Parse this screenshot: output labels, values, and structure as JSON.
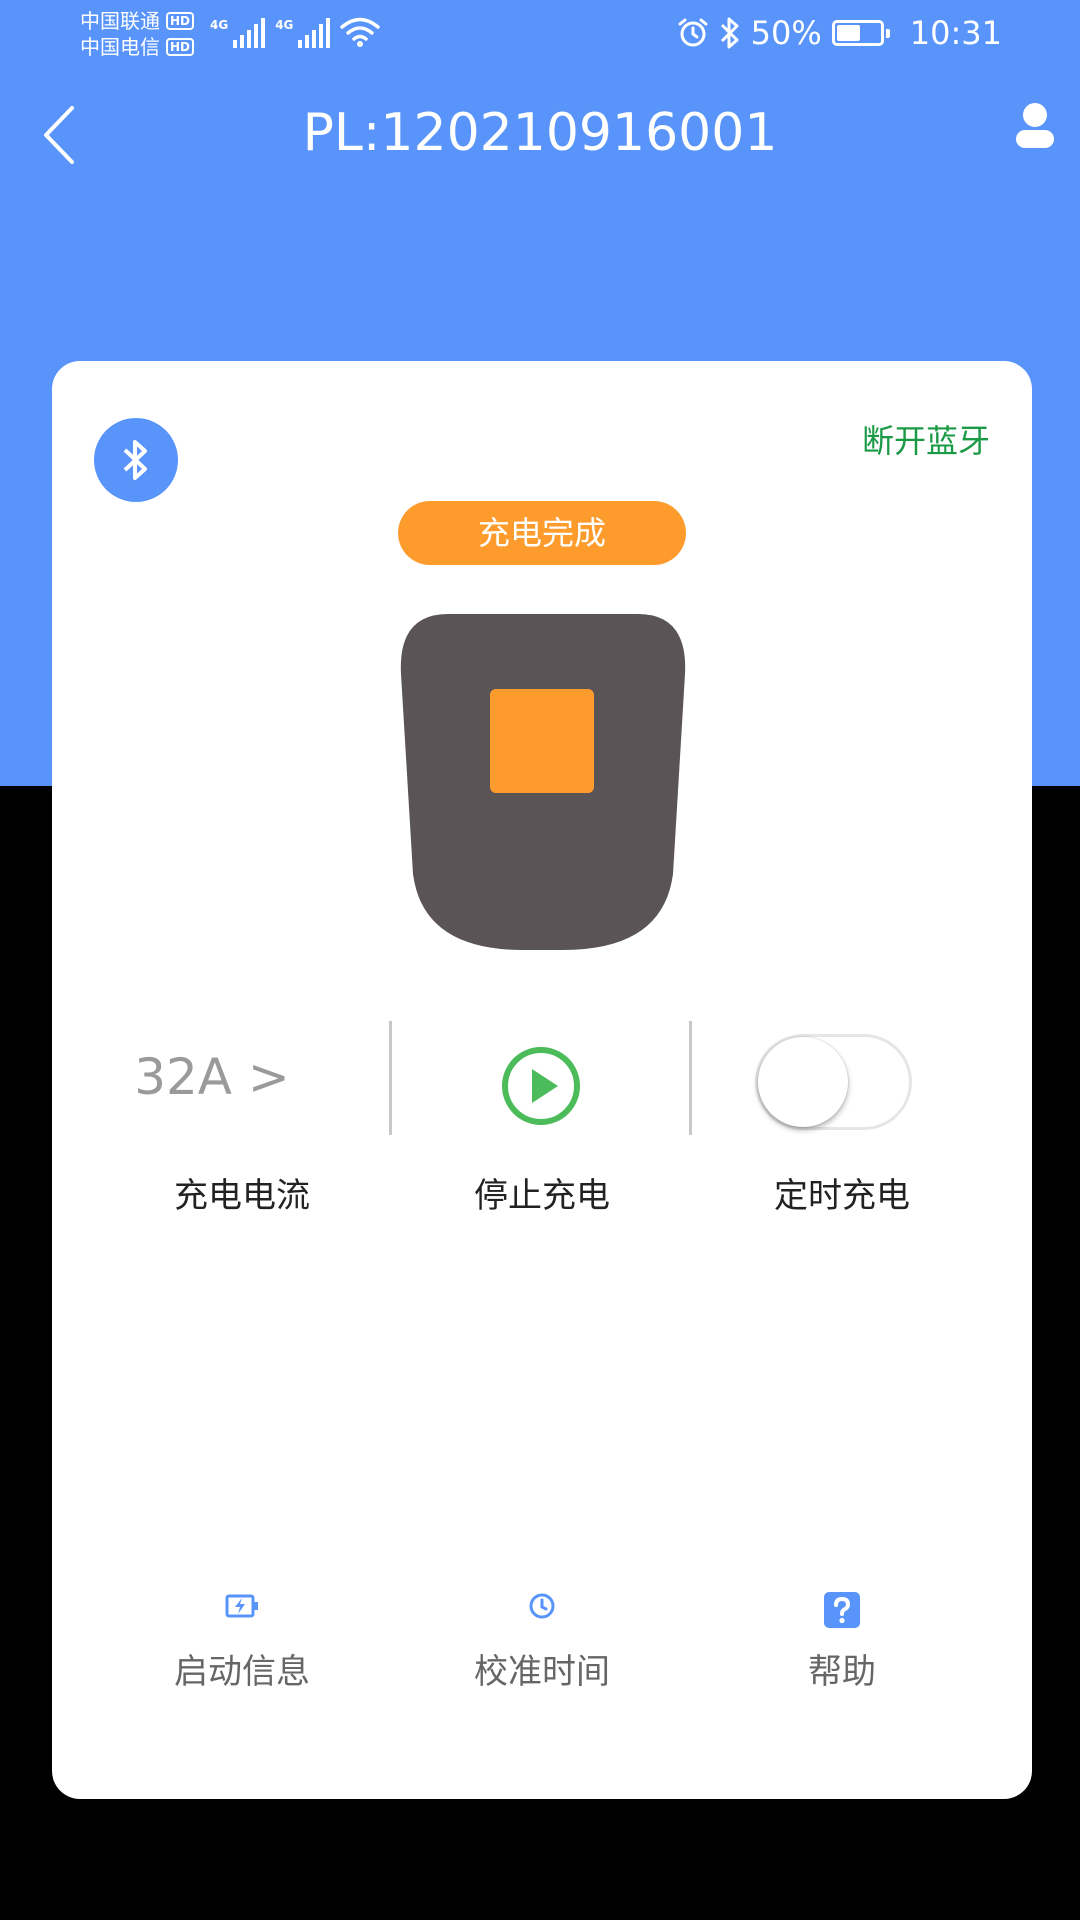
{
  "status_bar": {
    "carrier_1": "中国联通",
    "carrier_2": "中国电信",
    "hd_label": "HD",
    "network_1": "4G",
    "network_2": "4G",
    "battery_percent": "50%",
    "battery_level": 0.5,
    "time": "10:31",
    "icons": [
      "alarm-icon",
      "bluetooth-icon",
      "wifi-icon",
      "battery-icon"
    ]
  },
  "header": {
    "title": "PL:120210916001",
    "back_icon": "chevron-left-icon",
    "user_icon": "user-icon"
  },
  "card": {
    "bluetooth_icon": "bluetooth-icon",
    "disconnect_label": "断开蓝牙",
    "charge_status": "充电完成",
    "controls": {
      "current_value": "32A >",
      "current_label": "充电电流",
      "stop_label": "停止充电",
      "timer_label": "定时充电",
      "timer_enabled": false
    },
    "bottom_nav": [
      {
        "label": "启动信息",
        "icon": "battery-charge-icon"
      },
      {
        "label": "校准时间",
        "icon": "clock-icon"
      },
      {
        "label": "帮助",
        "icon": "help-icon"
      }
    ]
  },
  "colors": {
    "primary": "#5994fb",
    "accent_orange": "#fd9c2d",
    "link_green": "#1b9a46",
    "play_green": "#4cbb5a",
    "plug_gray": "#5a5456",
    "background": "#000000"
  }
}
